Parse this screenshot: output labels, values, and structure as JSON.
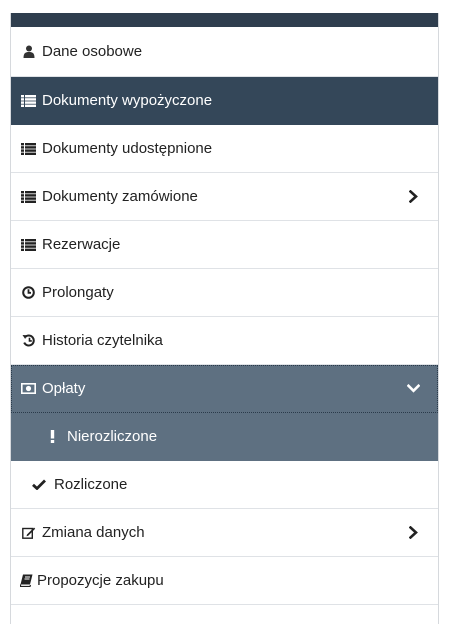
{
  "menu": {
    "items": [
      {
        "label": "Dane osobowe",
        "icon": "user-icon"
      },
      {
        "label": "Dokumenty wypożyczone",
        "icon": "list-icon",
        "state": "active"
      },
      {
        "label": "Dokumenty udostępnione",
        "icon": "list-icon"
      },
      {
        "label": "Dokumenty zamówione",
        "icon": "list-icon",
        "chevron": "chevron-right-icon"
      },
      {
        "label": "Rezerwacje",
        "icon": "list-icon"
      },
      {
        "label": "Prolongaty",
        "icon": "clock-icon"
      },
      {
        "label": "Historia czytelnika",
        "icon": "history-icon"
      },
      {
        "label": "Opłaty",
        "icon": "money-icon",
        "state": "expanded",
        "chevron": "chevron-down-icon",
        "children": [
          {
            "label": "Nierozliczone",
            "icon": "exclamation-icon",
            "state": "active"
          },
          {
            "label": "Rozliczone",
            "icon": "check-icon"
          }
        ]
      },
      {
        "label": "Zmiana danych",
        "icon": "edit-icon",
        "chevron": "chevron-right-icon"
      },
      {
        "label": "Propozycje zakupu",
        "icon": "book-icon"
      }
    ]
  },
  "colors": {
    "header_bar": "#2f3e4e",
    "active_item": "#344759",
    "expanded_item": "#5e7081",
    "text": "#222222",
    "divider": "#dfe2e6"
  }
}
